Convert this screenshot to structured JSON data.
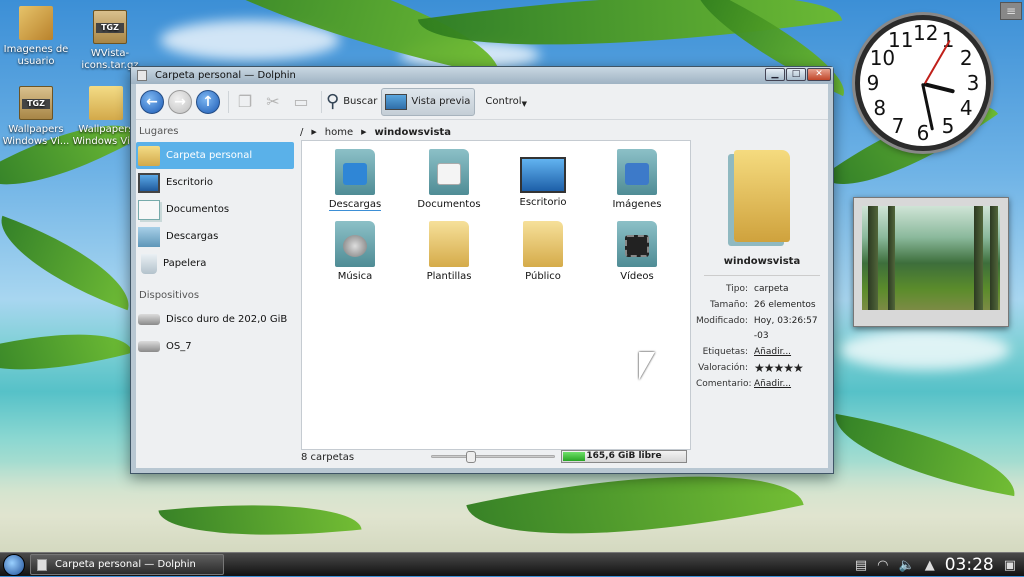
{
  "desktop": {
    "icons": [
      {
        "label": "Imagenes de usuario"
      },
      {
        "label": "WVista-icons.tar.gz",
        "badge": "TGZ"
      },
      {
        "label": "Wallpapers Windows Vi...",
        "badge": "TGZ"
      },
      {
        "label": "Wallpapers Windows Vi..."
      }
    ]
  },
  "clock_widget": {
    "numbers": [
      "12",
      "1",
      "2",
      "3",
      "4",
      "5",
      "6",
      "7",
      "8",
      "9",
      "10",
      "11"
    ]
  },
  "window": {
    "title": "Carpeta personal — Dolphin",
    "controls": {
      "minimize": "▁",
      "maximize": "□",
      "close": "✕"
    }
  },
  "toolbar": {
    "search_label": "Buscar",
    "preview_label": "Vista previa",
    "control_label": "Control"
  },
  "sidebar": {
    "places_heading": "Lugares",
    "places": [
      {
        "label": "Carpeta personal",
        "icon": "folder-home-icon"
      },
      {
        "label": "Escritorio",
        "icon": "desktop-icon"
      },
      {
        "label": "Documentos",
        "icon": "documents-icon"
      },
      {
        "label": "Descargas",
        "icon": "downloads-icon"
      },
      {
        "label": "Papelera",
        "icon": "trash-icon"
      }
    ],
    "devices_heading": "Dispositivos",
    "devices": [
      {
        "label": "Disco duro de 202,0 GiB",
        "icon": "hard-drive-icon"
      },
      {
        "label": "OS_7",
        "icon": "drive-unmounted-icon"
      }
    ]
  },
  "breadcrumb": {
    "root": "/",
    "home": "home",
    "current": "windowsvista"
  },
  "files": [
    {
      "name": "Descargas",
      "icon": "folder-downloads-icon"
    },
    {
      "name": "Documentos",
      "icon": "folder-documents-icon"
    },
    {
      "name": "Escritorio",
      "icon": "folder-desktop-icon"
    },
    {
      "name": "Imágenes",
      "icon": "folder-pictures-icon"
    },
    {
      "name": "Música",
      "icon": "folder-music-icon"
    },
    {
      "name": "Plantillas",
      "icon": "folder-templates-icon"
    },
    {
      "name": "Público",
      "icon": "folder-public-icon"
    },
    {
      "name": "Vídeos",
      "icon": "folder-videos-icon"
    }
  ],
  "info_panel": {
    "name": "windowsvista",
    "rows": [
      {
        "key": "Tipo:",
        "value": "carpeta"
      },
      {
        "key": "Tamaño:",
        "value": "26 elementos"
      },
      {
        "key": "Modificado:",
        "value": "Hoy, 03:26:57 -03"
      },
      {
        "key": "Etiquetas:",
        "value": "Añadir..."
      },
      {
        "key": "Valoración:",
        "value": "★★★★★"
      },
      {
        "key": "Comentario:",
        "value": "Añadir..."
      }
    ]
  },
  "statusbar": {
    "count_text": "8 carpetas",
    "free_space": "165,6 GiB libre",
    "free_fraction": 0.18,
    "zoom_fraction": 0.28
  },
  "taskbar": {
    "task_label": "Carpeta personal — Dolphin",
    "time": "03:28"
  },
  "colors": {
    "selection": "#5ab1e9",
    "accent": "#2a6fc9",
    "free_space_green": "#27a523"
  }
}
